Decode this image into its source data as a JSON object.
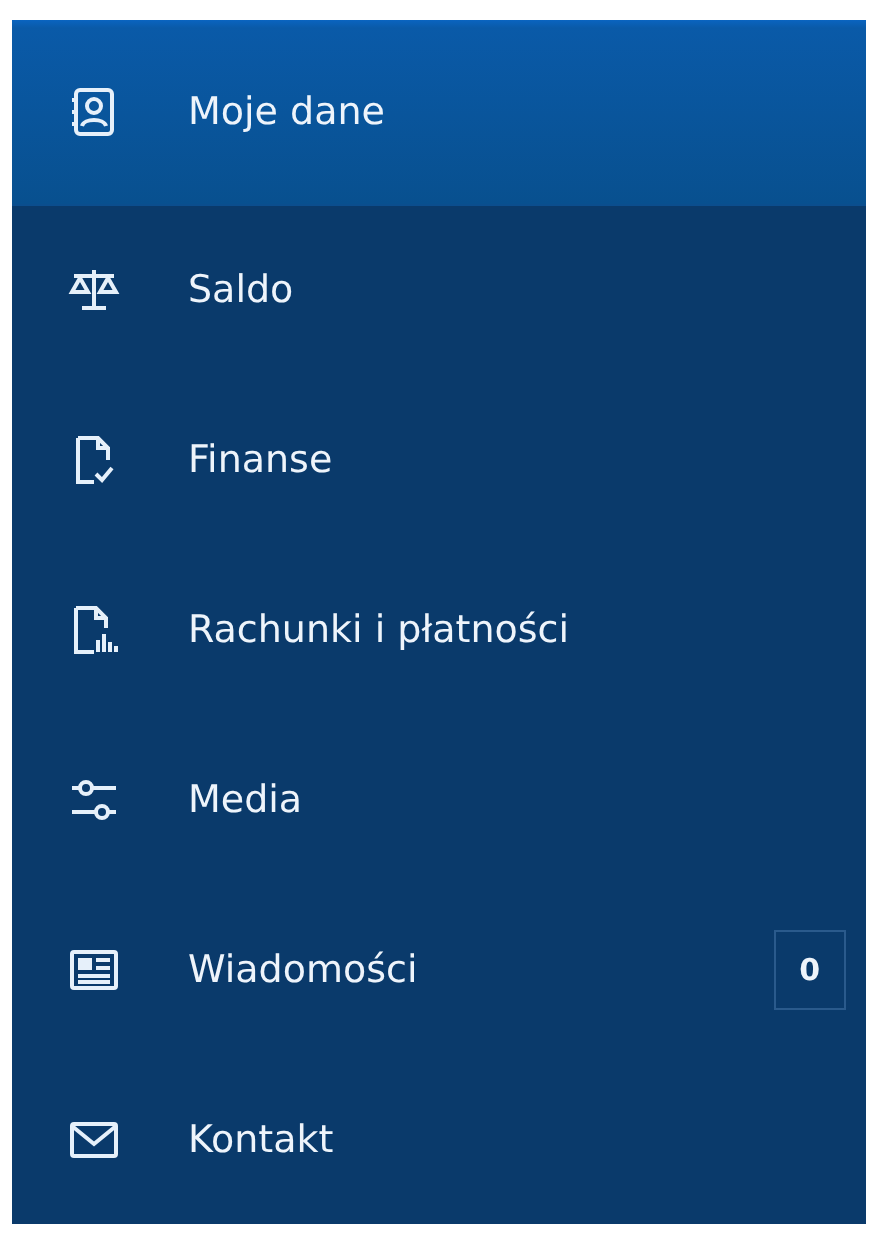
{
  "menu": [
    {
      "label": "Moje dane",
      "selected": true
    },
    {
      "label": "Saldo",
      "selected": false
    },
    {
      "label": "Finanse",
      "selected": false
    },
    {
      "label": "Rachunki i płatności",
      "selected": false
    },
    {
      "label": "Media",
      "selected": false
    },
    {
      "label": "Wiadomości",
      "selected": false,
      "badge": "0"
    },
    {
      "label": "Kontakt",
      "selected": false
    }
  ]
}
